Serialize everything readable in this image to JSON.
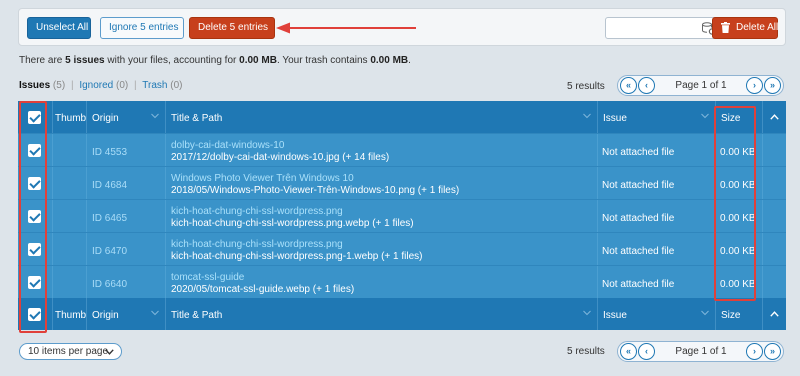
{
  "toolbar": {
    "unselect_all": "Unselect All",
    "ignore": "Ignore 5 entries",
    "delete_entries": "Delete 5 entries",
    "search_placeholder": "",
    "delete_all": "Delete All"
  },
  "summary": {
    "p1": "There are ",
    "issue_count": "5 issues",
    "p2": " with your files, accounting for ",
    "size": "0.00 MB",
    "p3": ". Your trash contains ",
    "trash": "0.00 MB",
    "p4": "."
  },
  "filters": {
    "issues_label": "Issues",
    "issues_count": "(5)",
    "ignored_label": "Ignored",
    "ignored_count": "(0)",
    "trash_label": "Trash",
    "trash_count": "(0)",
    "separator": "|"
  },
  "pagination": {
    "results": "5 results",
    "page_text": "Page 1 of 1",
    "first": "«",
    "prev": "‹",
    "next": "›",
    "last": "»"
  },
  "table": {
    "headers": {
      "thumb": "Thumb",
      "origin": "Origin",
      "title": "Title & Path",
      "issue": "Issue",
      "size": "Size"
    },
    "rows": [
      {
        "id": "ID 4553",
        "title": "dolby-cai-dat-windows-10",
        "path": "2017/12/dolby-cai-dat-windows-10.jpg (+ 14 files)",
        "issue": "Not attached file",
        "size": "0.00 KB"
      },
      {
        "id": "ID 4684",
        "title": "Windows Photo Viewer Trên Windows 10",
        "path": "2018/05/Windows-Photo-Viewer-Trên-Windows-10.png (+ 1 files)",
        "issue": "Not attached file",
        "size": "0.00 KB"
      },
      {
        "id": "ID 6465",
        "title": "kich-hoat-chung-chi-ssl-wordpress.png",
        "path": "kich-hoat-chung-chi-ssl-wordpress.png.webp (+ 1 files)",
        "issue": "Not attached file",
        "size": "0.00 KB"
      },
      {
        "id": "ID 6470",
        "title": "kich-hoat-chung-chi-ssl-wordpress.png",
        "path": "kich-hoat-chung-chi-ssl-wordpress.png-1.webp (+ 1 files)",
        "issue": "Not attached file",
        "size": "0.00 KB"
      },
      {
        "id": "ID 6640",
        "title": "tomcat-ssl-guide",
        "path": "2020/05/tomcat-ssl-guide.webp (+ 1 files)",
        "issue": "Not attached file",
        "size": "0.00 KB"
      }
    ]
  },
  "per_page": "10 items per page",
  "colors": {
    "primary": "#1f78b4",
    "row": "#3a93c9",
    "danger": "#c7401c",
    "annotation": "#e0403a"
  }
}
